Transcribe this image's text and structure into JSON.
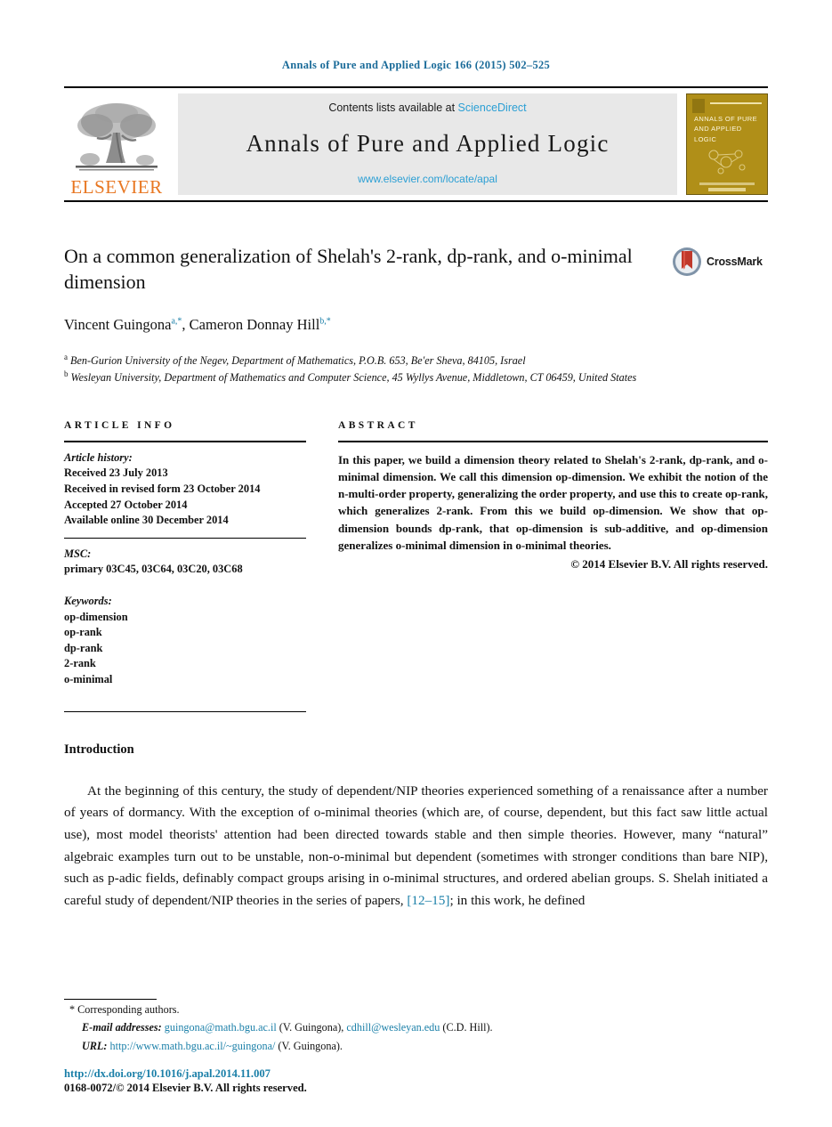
{
  "running_head": "Annals of Pure and Applied Logic 166 (2015) 502–525",
  "masthead": {
    "publisher_wordmark": "ELSEVIER",
    "contents_line_prefix": "Contents lists available at ",
    "contents_link": "ScienceDirect",
    "journal_name": "Annals of Pure and Applied Logic",
    "journal_url": "www.elsevier.com/locate/apal",
    "cover_title": "ANNALS OF PURE AND APPLIED LOGIC",
    "cover_color": "#b08f18"
  },
  "article": {
    "title": "On a common generalization of Shelah's 2-rank, dp-rank, and o-minimal dimension",
    "authors": [
      {
        "name": "Vincent Guingona",
        "marks": "a,*"
      },
      {
        "name": "Cameron Donnay Hill",
        "marks": "b,*"
      }
    ],
    "authors_line_1_name": "Vincent Guingona",
    "authors_line_1_sup_letter": "a",
    "authors_line_1_sup_star": ",*",
    "authors_line_2_name": "Cameron Donnay Hill",
    "authors_line_2_sup_letter": "b",
    "authors_line_2_sup_star": ",*",
    "affiliations": [
      {
        "mark": "a",
        "text": "Ben-Gurion University of the Negev, Department of Mathematics, P.O.B. 653, Be'er Sheva, 84105, Israel"
      },
      {
        "mark": "b",
        "text": "Wesleyan University, Department of Mathematics and Computer Science, 45 Wyllys Avenue, Middletown, CT 06459, United States"
      }
    ],
    "crossmark_label": "CrossMark"
  },
  "info": {
    "heading": "ARTICLE INFO",
    "history_label": "Article history:",
    "history": [
      "Received 23 July 2013",
      "Received in revised form 23 October 2014",
      "Accepted 27 October 2014",
      "Available online 30 December 2014"
    ],
    "msc_label": "MSC:",
    "msc_codes": "primary 03C45, 03C64, 03C20, 03C68",
    "keywords_label": "Keywords:",
    "keywords": [
      "op-dimension",
      "op-rank",
      "dp-rank",
      "2-rank",
      "o-minimal"
    ]
  },
  "abstract": {
    "heading": "ABSTRACT",
    "text": "In this paper, we build a dimension theory related to Shelah's 2-rank, dp-rank, and o-minimal dimension. We call this dimension op-dimension. We exhibit the notion of the n-multi-order property, generalizing the order property, and use this to create op-rank, which generalizes 2-rank. From this we build op-dimension. We show that op-dimension bounds dp-rank, that op-dimension is sub-additive, and op-dimension generalizes o-minimal dimension in o-minimal theories.",
    "copyright": "© 2014 Elsevier B.V. All rights reserved."
  },
  "introduction": {
    "heading": "Introduction",
    "paragraph_part_1": "At the beginning of this century, the study of dependent/NIP theories experienced something of a renaissance after a number of years of dormancy. With the exception of o-minimal theories (which are, of course, dependent, but this fact saw little actual use), most model theorists' attention had been directed towards stable and then simple theories. However, many “natural” algebraic examples turn out to be unstable, non-o-minimal but dependent (sometimes with stronger conditions than bare NIP), such as p-adic fields, definably compact groups arising in o-minimal structures, and ordered abelian groups. S. Shelah initiated a careful study of dependent/NIP theories in the series of papers, ",
    "citation": "[12–15]",
    "paragraph_part_2": "; in this work, he defined"
  },
  "footnotes": {
    "corresponding": "Corresponding authors.",
    "email_label": "E-mail addresses:",
    "email_1": "guingona@math.bgu.ac.il",
    "email_1_owner": "(V. Guingona),",
    "email_2": "cdhill@wesleyan.edu",
    "email_2_owner": "(C.D. Hill).",
    "url_label": "URL:",
    "url_value": "http://www.math.bgu.ac.il/~guingona/",
    "url_owner": "(V. Guingona)."
  },
  "bottom": {
    "doi": "http://dx.doi.org/10.1016/j.apal.2014.11.007",
    "issn_line": "0168-0072/© 2014 Elsevier B.V. All rights reserved."
  },
  "colors": {
    "link": "#1a7fa8",
    "sciencedirect": "#2b9fd4",
    "elsevier_orange": "#e87722",
    "crossmark_red": "#c0392b"
  }
}
